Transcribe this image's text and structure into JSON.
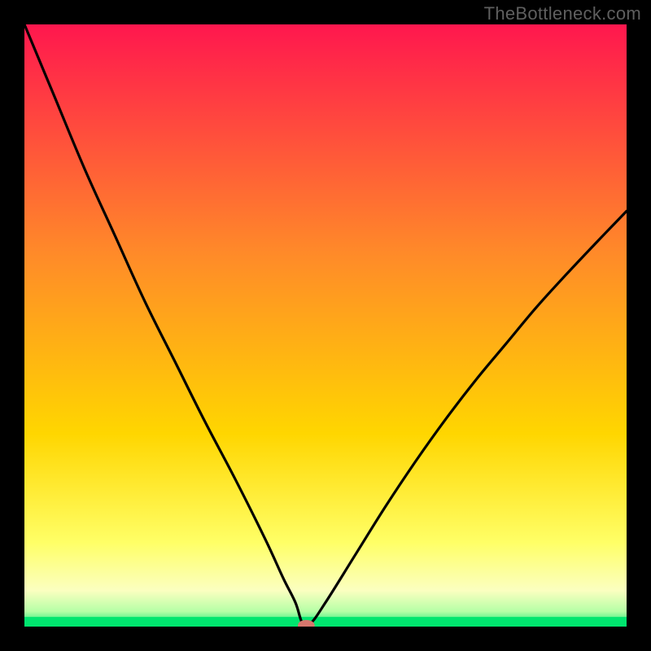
{
  "watermark": "TheBottleneck.com",
  "chart_data": {
    "type": "line",
    "title": "",
    "xlabel": "",
    "ylabel": "",
    "xlim": [
      0,
      100
    ],
    "ylim": [
      0,
      100
    ],
    "grid": false,
    "legend": false,
    "annotations": [],
    "background": {
      "type": "vertical-gradient",
      "stops": [
        {
          "pos": 0.0,
          "color": "#ff174e"
        },
        {
          "pos": 0.38,
          "color": "#ff8a29"
        },
        {
          "pos": 0.68,
          "color": "#ffd600"
        },
        {
          "pos": 0.86,
          "color": "#ffff66"
        },
        {
          "pos": 0.94,
          "color": "#fbffc0"
        },
        {
          "pos": 0.975,
          "color": "#b5ffa6"
        },
        {
          "pos": 1.0,
          "color": "#00e66f"
        }
      ]
    },
    "series": [
      {
        "name": "bottleneck-curve",
        "color": "#000000",
        "x": [
          0,
          5,
          10,
          15,
          20,
          25,
          30,
          35,
          40,
          43,
          45,
          46.2,
          47.5,
          50,
          55,
          60,
          65,
          70,
          75,
          80,
          85,
          90,
          95,
          100
        ],
        "y": [
          100,
          88,
          76,
          65,
          54,
          44,
          34,
          24.5,
          14.5,
          8,
          4,
          0.5,
          0.5,
          4,
          12,
          20,
          27.5,
          34.5,
          41,
          47,
          53,
          58.5,
          63.8,
          69
        ]
      }
    ],
    "marker": {
      "name": "minimum-marker",
      "x": 46.8,
      "y": 0.2,
      "rx_pct": 1.4,
      "ry_pct": 0.9,
      "fill": "#d7766d"
    },
    "green_shelf_height_pct": 1.6
  }
}
